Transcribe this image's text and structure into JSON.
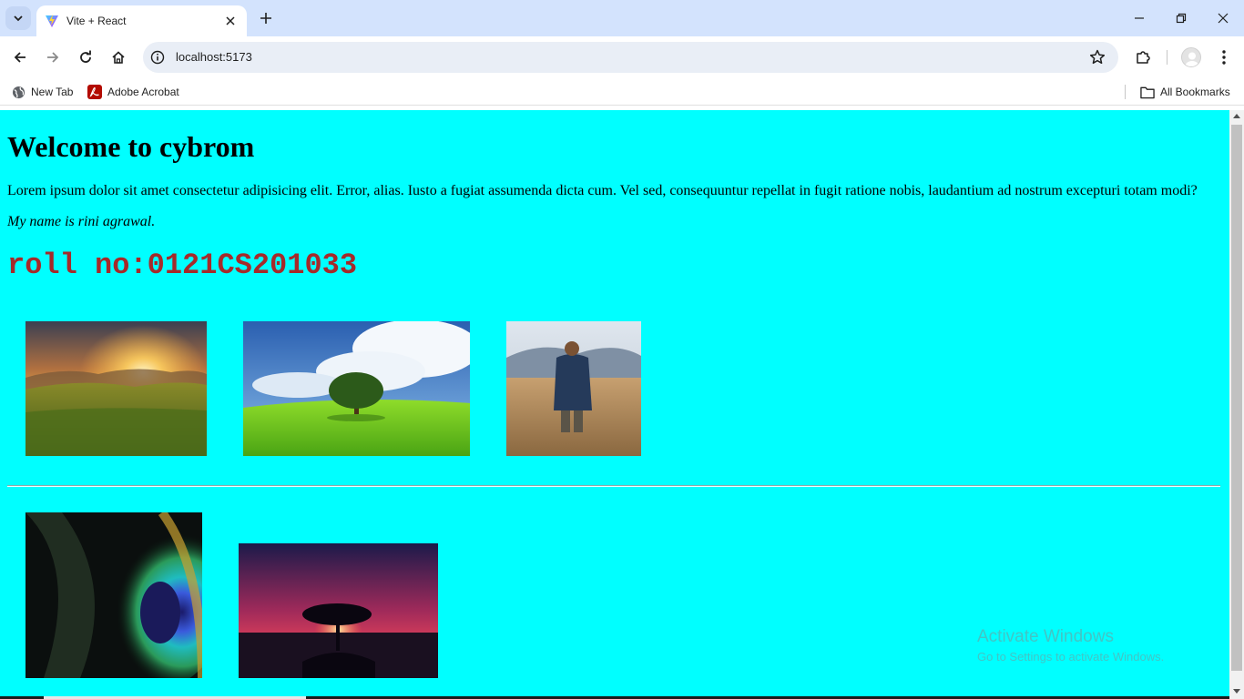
{
  "browser": {
    "tab_title": "Vite + React",
    "url": "localhost:5173",
    "bookmarks": [
      {
        "label": "New Tab",
        "icon": "globe-icon"
      },
      {
        "label": "Adobe Acrobat",
        "icon": "acrobat-icon"
      }
    ],
    "all_bookmarks_label": "All Bookmarks"
  },
  "page": {
    "background": "#00ffff",
    "heading": "Welcome to cybrom",
    "paragraph": "Lorem ipsum dolor sit amet consectetur adipisicing elit. Error, alias. Iusto a fugiat assumenda dicta cum. Vel sed, consequuntur repellat in fugit ratione nobis, laudantium ad nostrum excepturi totam modi?",
    "name_line": "My name is rini agrawal.",
    "roll_line": "roll no:0121CS201033",
    "roll_color": "#a52a2a",
    "images_row1": [
      "sunset-hills-image",
      "green-field-tree-image",
      "man-in-wheat-field-image"
    ],
    "images_row2": [
      "peacock-feather-image",
      "tree-at-dusk-image"
    ]
  },
  "watermark": {
    "line1": "Activate Windows",
    "line2": "Go to Settings to activate Windows."
  }
}
